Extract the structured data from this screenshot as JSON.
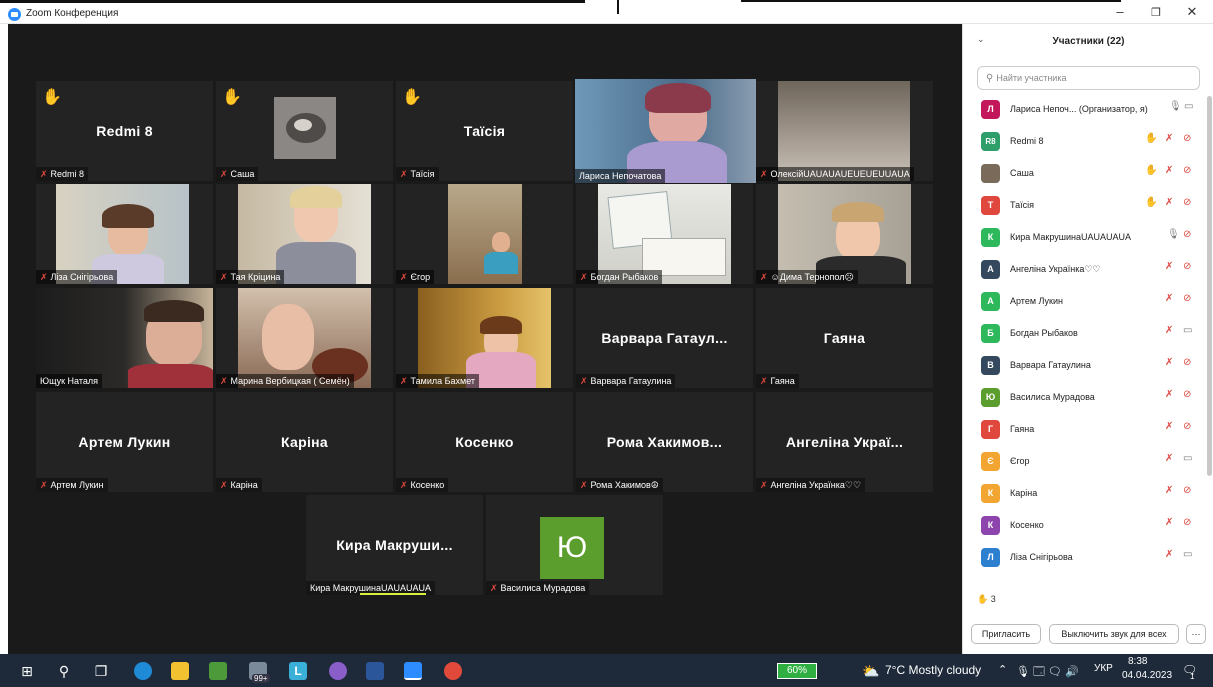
{
  "window": {
    "title": "Zoom Конференция",
    "controls": {
      "minimize": "–",
      "maximize": "❐",
      "close": "✕"
    }
  },
  "tiles": [
    {
      "name_big": "Redmi 8",
      "label": "Redmi 8",
      "hand": true,
      "muted": true
    },
    {
      "name_big": "",
      "label": "Саша",
      "hand": true,
      "muted": true
    },
    {
      "name_big": "Таїсія",
      "label": "Таїсія",
      "hand": true,
      "muted": true
    },
    {
      "name_big": "",
      "label": "Лариса Непочатова",
      "hand": false,
      "muted": false,
      "speaking": true
    },
    {
      "name_big": "",
      "label": "ОлексійUAUAUAUEUEUEUUAUA",
      "hand": false,
      "muted": true
    },
    {
      "name_big": "",
      "label": "Ліза Снігірьова",
      "hand": false,
      "muted": true
    },
    {
      "name_big": "",
      "label": "Тая Кріцина",
      "hand": false,
      "muted": true
    },
    {
      "name_big": "",
      "label": "Єгор",
      "hand": false,
      "muted": true
    },
    {
      "name_big": "",
      "label": "Богдан Рыбаков",
      "hand": false,
      "muted": true
    },
    {
      "name_big": "",
      "label": "☺Дима Тернопол☹",
      "hand": false,
      "muted": true
    },
    {
      "name_big": "",
      "label": "Ющук Наталя",
      "hand": false,
      "muted": false
    },
    {
      "name_big": "",
      "label": "Марина Вербицкая ( Семён)",
      "hand": false,
      "muted": true
    },
    {
      "name_big": "",
      "label": "Тамила Бахмет",
      "hand": false,
      "muted": true
    },
    {
      "name_big": "Варвара Гатаул...",
      "label": "Варвара Гатаулина",
      "hand": false,
      "muted": true
    },
    {
      "name_big": "Гаяна",
      "label": "Гаяна",
      "hand": false,
      "muted": true
    },
    {
      "name_big": "Артем Лукин",
      "label": "Артем Лукин",
      "hand": false,
      "muted": true
    },
    {
      "name_big": "Каріна",
      "label": "Каріна",
      "hand": false,
      "muted": true
    },
    {
      "name_big": "Косенко",
      "label": "Косенко",
      "hand": false,
      "muted": true
    },
    {
      "name_big": "Рома Хакимов...",
      "label": "Рома Хакимов☮",
      "hand": false,
      "muted": true
    },
    {
      "name_big": "Ангеліна Украї...",
      "label": "Ангеліна Українка♡♡",
      "hand": false,
      "muted": true
    },
    {
      "name_big": "Кира Макруши...",
      "label": "Кира МакрушинаUAUAUAUA",
      "hand": false,
      "muted": false
    },
    {
      "name_big": "",
      "label": "Василиса Мурадова",
      "hand": false,
      "muted": true,
      "avatar_letter": "Ю"
    }
  ],
  "panel": {
    "collapse_icon": "⌄",
    "title": "Участники (22)",
    "search_placeholder": "Найти участника",
    "participants": [
      {
        "initials": "Л",
        "color": "#c2185b",
        "name": "Лариса Непоч... (Организатор, я)",
        "hand": false,
        "mic": "on",
        "video": "on"
      },
      {
        "initials": "R8",
        "color": "#2e9e6b",
        "name": "Redmi 8",
        "hand": true,
        "mic": "off",
        "video": "off"
      },
      {
        "initials": "",
        "color": "#7a6a5a",
        "name": "Саша",
        "hand": true,
        "mic": "off",
        "video": "off"
      },
      {
        "initials": "Т",
        "color": "#e0483e",
        "name": "Таїсія",
        "hand": true,
        "mic": "off",
        "video": "off"
      },
      {
        "initials": "К",
        "color": "#2eb85c",
        "name": "Кира МакрушинаUAUAUAUA",
        "hand": false,
        "mic": "on",
        "video": "off"
      },
      {
        "initials": "А",
        "color": "#34495e",
        "name": "Ангеліна Українка♡♡",
        "hand": false,
        "mic": "off",
        "video": "off"
      },
      {
        "initials": "А",
        "color": "#2eb85c",
        "name": "Артем Лукин",
        "hand": false,
        "mic": "off",
        "video": "off"
      },
      {
        "initials": "Б",
        "color": "#2eb85c",
        "name": "Богдан Рыбаков",
        "hand": false,
        "mic": "off",
        "video": "on"
      },
      {
        "initials": "В",
        "color": "#34495e",
        "name": "Варвара Гатаулина",
        "hand": false,
        "mic": "off",
        "video": "off"
      },
      {
        "initials": "Ю",
        "color": "#5b9e2d",
        "name": "Василиса Мурадова",
        "hand": false,
        "mic": "off",
        "video": "off"
      },
      {
        "initials": "Г",
        "color": "#e0483e",
        "name": "Гаяна",
        "hand": false,
        "mic": "off",
        "video": "off"
      },
      {
        "initials": "Є",
        "color": "#f2a531",
        "name": "Єгор",
        "hand": false,
        "mic": "off",
        "video": "on"
      },
      {
        "initials": "К",
        "color": "#f2a531",
        "name": "Каріна",
        "hand": false,
        "mic": "off",
        "video": "off"
      },
      {
        "initials": "К",
        "color": "#8e44ad",
        "name": "Косенко",
        "hand": false,
        "mic": "off",
        "video": "off"
      },
      {
        "initials": "Л",
        "color": "#2d7fd0",
        "name": "Ліза Снігірьова",
        "hand": false,
        "mic": "off",
        "video": "on"
      }
    ],
    "hands_raised": "3",
    "invite_label": "Пригласить",
    "mute_all_label": "Выключить звук для всех",
    "more_label": "···"
  },
  "taskbar": {
    "battery": "60%",
    "weather": "7°C  Mostly cloudy",
    "language": "УКР",
    "time": "8:38",
    "date": "04.04.2023",
    "badge_count": "99+",
    "notification_count": "1"
  },
  "colors": {
    "zoom_blue": "#2d8cff",
    "tile_bg": "#232323",
    "muted_red": "#e0483e",
    "hand_yellow": "#f2b33d",
    "speaking_outline": "#b8e04a"
  }
}
